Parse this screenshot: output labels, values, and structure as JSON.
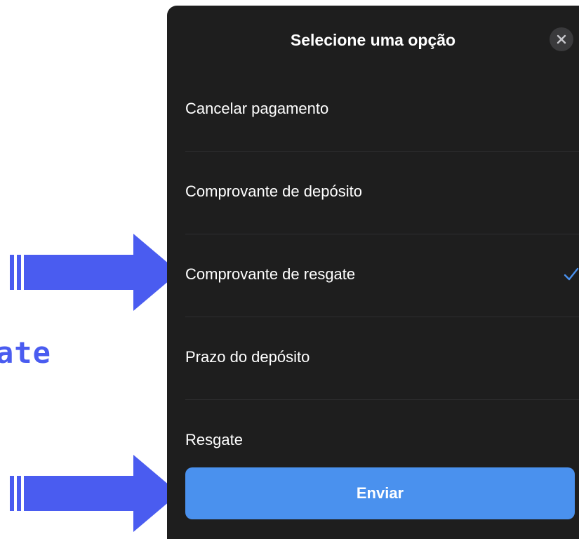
{
  "background": {
    "partial_text": "ate",
    "arrow_color": "#4a5cf0"
  },
  "sheet": {
    "title": "Selecione uma opção",
    "close_icon": "close-icon",
    "options": [
      {
        "label": "Cancelar pagamento",
        "selected": false
      },
      {
        "label": "Comprovante de depósito",
        "selected": false
      },
      {
        "label": "Comprovante de resgate",
        "selected": true
      },
      {
        "label": "Prazo do depósito",
        "selected": false
      },
      {
        "label": "Resgate",
        "selected": false
      }
    ],
    "submit_label": "Enviar",
    "accent_color": "#4a91ee",
    "background_color": "#1e1e1e"
  }
}
